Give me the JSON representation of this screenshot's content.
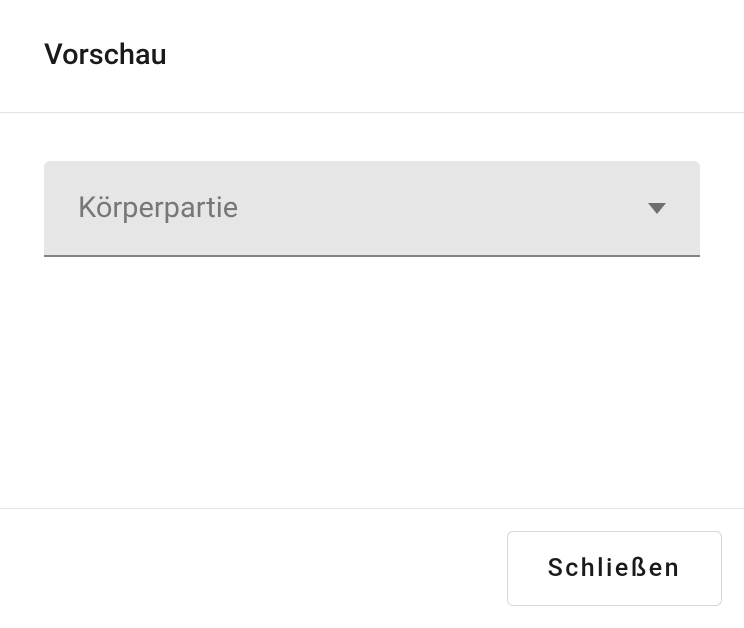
{
  "header": {
    "title": "Vorschau"
  },
  "content": {
    "select": {
      "label": "Körperpartie"
    }
  },
  "footer": {
    "close_label": "Schließen"
  }
}
